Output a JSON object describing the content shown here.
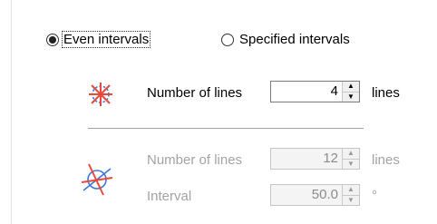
{
  "mode": {
    "even_label": "Even intervals",
    "specified_label": "Specified intervals",
    "selected": "even"
  },
  "even": {
    "lines_label": "Number of lines",
    "lines_value": "4",
    "lines_unit": "lines"
  },
  "specified": {
    "lines_label": "Number of lines",
    "lines_value": "12",
    "lines_unit": "lines",
    "interval_label": "Interval",
    "interval_value": "50.0",
    "interval_unit": "°"
  },
  "icons": {
    "even": "even-division-icon",
    "specified": "specified-division-icon"
  },
  "colors": {
    "icon_red": "#e8493c",
    "icon_blue": "#3a78d8"
  }
}
